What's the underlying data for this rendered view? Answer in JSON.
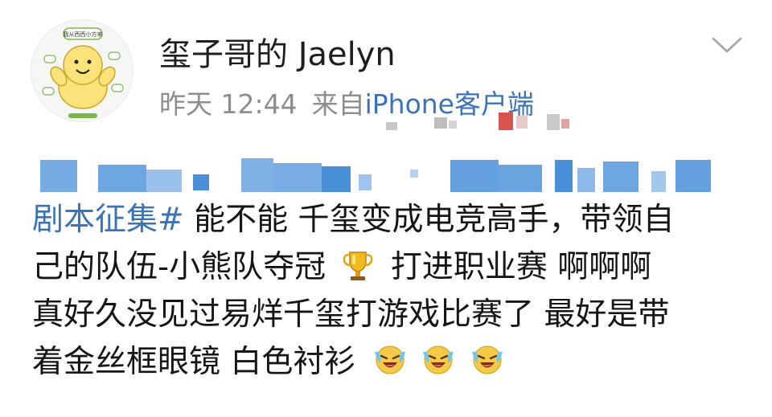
{
  "header": {
    "username": "玺子哥的 Jaelyn",
    "time": "昨天 12:44",
    "source_prefix": "来自",
    "source_client": "iPhone客户端",
    "avatar_text": "我从西西小方来"
  },
  "post": {
    "hashtag": "剧本征集#",
    "line1_text": " 能不能 千玺变成电竞高手，带领自",
    "line2_text": "己的队伍-小熊队夺冠 ",
    "line2_after_trophy": " 打进职业赛 啊啊啊",
    "line3_text": "真好久没见过易烊千玺打游戏比赛了 最好是带",
    "line4_text": "着金丝框眼镜 白色衬衫 "
  },
  "icons": {
    "dropdown": "chevron-down-icon",
    "trophy": "trophy-emoji-icon",
    "laugh": "laughing-crying-emoji-icon"
  },
  "colors": {
    "link": "#3b73b4",
    "meta": "#8d8d8d",
    "text": "#151515",
    "censor": "#4a90d9"
  }
}
